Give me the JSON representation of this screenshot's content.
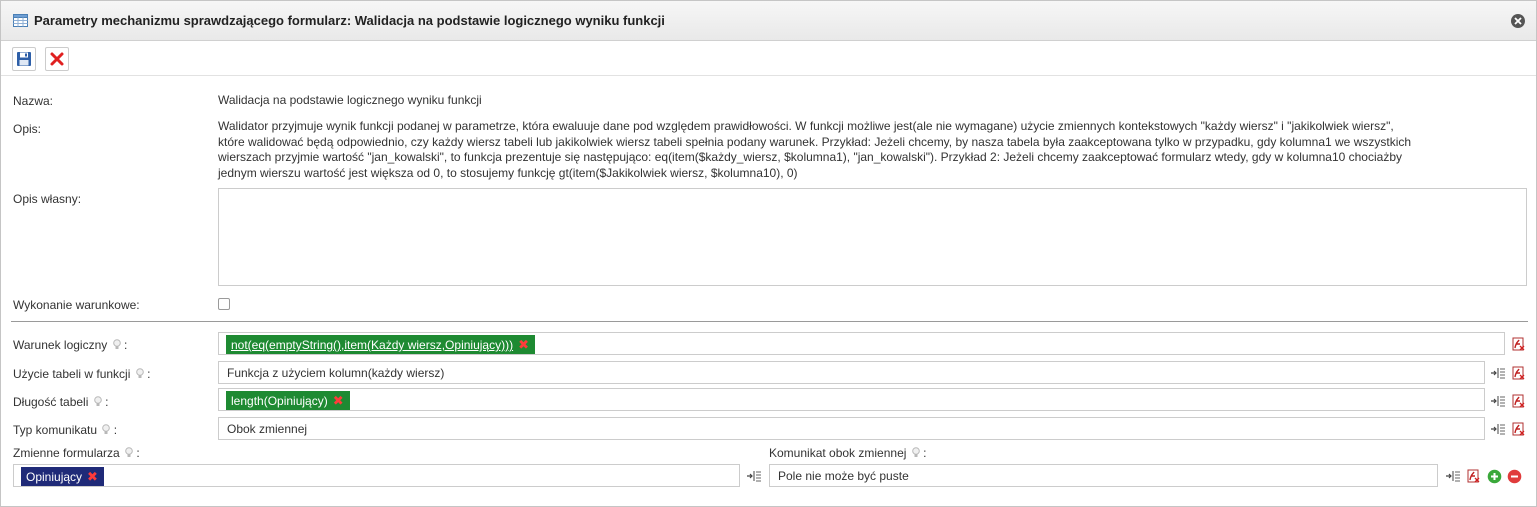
{
  "window": {
    "title": "Parametry mechanizmu sprawdzającego formularz: Walidacja na podstawie logicznego wyniku funkcji"
  },
  "toolbar": {
    "save_icon": "floppy-disk-icon",
    "cancel_icon": "red-x-icon"
  },
  "form": {
    "name": {
      "label": "Nazwa:",
      "value": "Walidacja na podstawie logicznego wyniku funkcji"
    },
    "description": {
      "label": "Opis:",
      "lines": [
        "Walidator przyjmuje wynik funkcji podanej w parametrze, która ewaluuje dane pod względem prawidłowości. W funkcji możliwe jest(ale nie wymagane) użycie zmiennych kontekstowych \"każdy wiersz\" i \"jakikolwiek wiersz\",",
        "które walidować będą odpowiednio, czy każdy wiersz tabeli lub jakikolwiek wiersz tabeli spełnia podany warunek. Przykład: Jeżeli chcemy, by nasza tabela była zaakceptowana tylko w przypadku, gdy kolumna1 we wszystkich",
        "wierszach przyjmie wartość \"jan_kowalski\", to funkcja prezentuje się następująco: eq(item($każdy_wiersz, $kolumna1), \"jan_kowalski\"). Przykład 2: Jeżeli chcemy zaakceptować formularz wtedy, gdy w kolumna10 chociażby",
        "jednym wierszu wartość jest większa od 0, to stosujemy funkcję gt(item($Jakikolwiek wiersz, $kolumna10), 0)"
      ]
    },
    "own_description": {
      "label": "Opis własny:",
      "value": ""
    },
    "conditional": {
      "label": "Wykonanie warunkowe:",
      "checked": false
    },
    "logical_condition": {
      "label": "Warunek logiczny",
      "chip": "not(eq(emptyString(),item(Każdy wiersz,Opiniujący)))"
    },
    "table_usage": {
      "label": "Użycie tabeli w funkcji",
      "value": "Funkcja z użyciem kolumn(każdy wiersz)"
    },
    "table_length": {
      "label": "Długość tabeli",
      "chip": "length(Opiniujący)"
    },
    "message_type": {
      "label": "Typ komunikatu",
      "value": "Obok zmiennej"
    },
    "form_variables": {
      "label": "Zmienne formularza",
      "chip": "Opiniujący"
    },
    "message_next": {
      "label": "Komunikat obok zmiennej",
      "value": "Pole nie może być puste"
    },
    "colon": ":"
  },
  "colors": {
    "chip_green": "#1e8a32",
    "chip_navy": "#1f2a78",
    "remove_x": "#ff3b3b"
  }
}
